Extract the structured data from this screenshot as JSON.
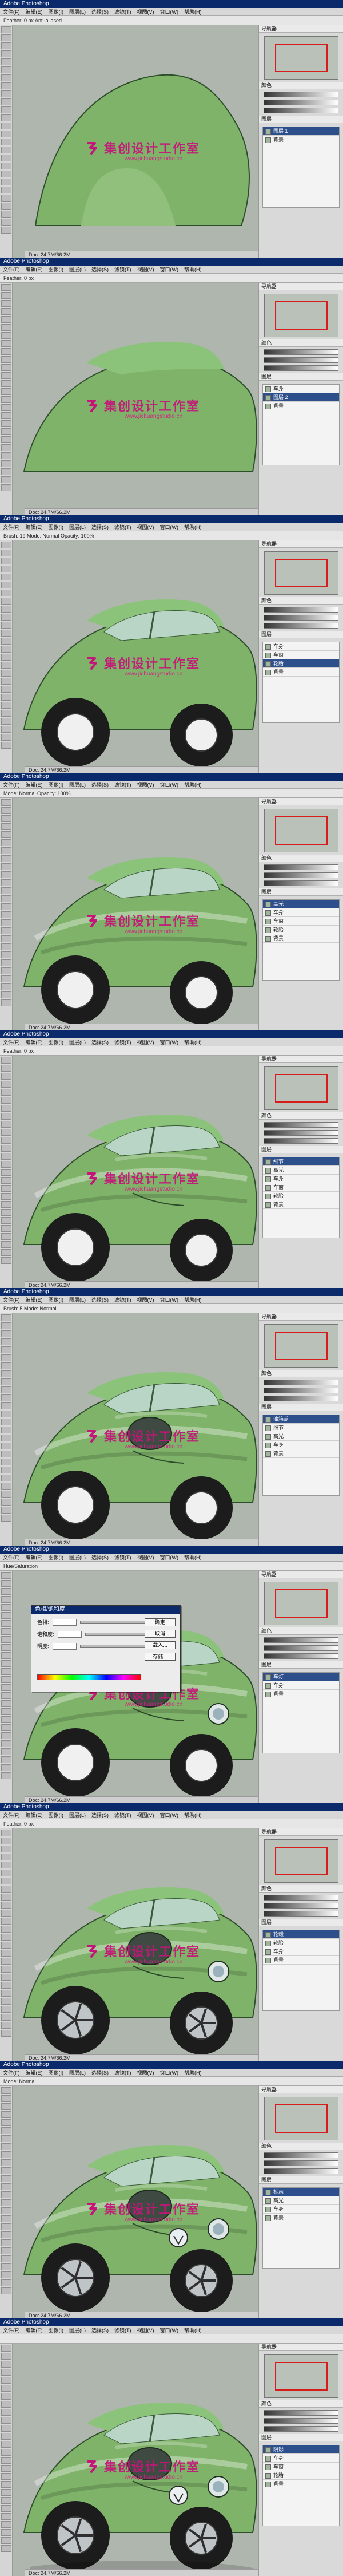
{
  "watermark": {
    "brand_cn": "集创设计工作室",
    "brand_url": "www.jichuangstudio.cn"
  },
  "frames": [
    {
      "title": "Adobe Photoshop",
      "options": "Feather: 0 px   Anti-aliased",
      "status": "Doc: 24.7M/66.2M",
      "layers": [
        "图层 1",
        "背景"
      ],
      "active": 0
    },
    {
      "title": "Adobe Photoshop",
      "options": "Feather: 0 px",
      "status": "Doc: 24.7M/66.2M",
      "layers": [
        "车身",
        "图层 2",
        "背景"
      ],
      "active": 1
    },
    {
      "title": "Adobe Photoshop",
      "options": "Brush: 19  Mode: Normal  Opacity: 100%",
      "status": "Doc: 24.7M/66.2M",
      "layers": [
        "车身",
        "车窗",
        "轮胎",
        "背景"
      ],
      "active": 2
    },
    {
      "title": "Adobe Photoshop",
      "options": "Mode: Normal  Opacity: 100%",
      "status": "Doc: 24.7M/66.2M",
      "layers": [
        "高光",
        "车身",
        "车窗",
        "轮胎",
        "背景"
      ],
      "active": 0
    },
    {
      "title": "Adobe Photoshop",
      "options": "Feather: 0 px",
      "status": "Doc: 24.7M/66.2M",
      "layers": [
        "细节",
        "高光",
        "车身",
        "车窗",
        "轮胎",
        "背景"
      ],
      "active": 0
    },
    {
      "title": "Adobe Photoshop",
      "options": "Brush: 5  Mode: Normal",
      "status": "Doc: 24.7M/66.2M",
      "layers": [
        "油箱盖",
        "细节",
        "高光",
        "车身",
        "背景"
      ],
      "active": 0
    },
    {
      "title": "Adobe Photoshop",
      "options": "Hue/Saturation",
      "status": "Doc: 24.7M/66.2M",
      "layers": [
        "车灯",
        "车身",
        "背景"
      ],
      "active": 0,
      "dialog": {
        "title": "色相/饱和度",
        "hue_label": "色相:",
        "sat_label": "饱和度:",
        "light_label": "明度:",
        "ok": "确定",
        "cancel": "取消",
        "load": "载入...",
        "save": "存储..."
      }
    },
    {
      "title": "Adobe Photoshop",
      "options": "Feather: 0 px",
      "status": "Doc: 24.7M/66.2M",
      "layers": [
        "轮毂",
        "轮胎",
        "车身",
        "背景"
      ],
      "active": 0
    },
    {
      "title": "Adobe Photoshop",
      "options": "Mode: Normal",
      "status": "Doc: 24.7M/66.2M",
      "layers": [
        "标志",
        "高光",
        "车身",
        "背景"
      ],
      "active": 0
    },
    {
      "title": "Adobe Photoshop",
      "options": "",
      "status": "Doc: 24.7M/66.2M",
      "layers": [
        "阴影",
        "车身",
        "车窗",
        "轮胎",
        "背景"
      ],
      "active": 0
    }
  ],
  "menu": [
    "文件(F)",
    "编辑(E)",
    "图像(I)",
    "图层(L)",
    "选择(S)",
    "滤镜(T)",
    "视图(V)",
    "窗口(W)",
    "帮助(H)"
  ],
  "panels": {
    "navigator": "导航器",
    "color": "颜色",
    "layers": "图层"
  },
  "colors": {
    "car_green": "#7fb36a",
    "car_dark": "#4f8b46",
    "glass": "#b9d5c6",
    "tire": "#1c1c1c",
    "rim": "#d8d8d8",
    "watermark": "#c5157a"
  }
}
